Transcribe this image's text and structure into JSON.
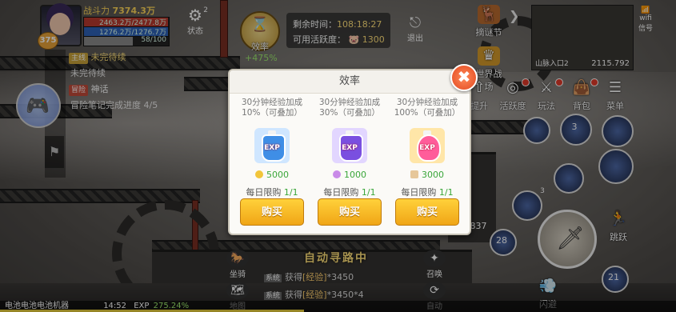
{
  "hud": {
    "power_label": "战斗力",
    "power_value": "7374.3万",
    "level": "375",
    "hp_text": "2463.2万/2477.8万",
    "mp_text": "1276.2万/1276.7万",
    "xp_text": "58/100",
    "status_label": "状态",
    "status_count": "2",
    "efficiency_label": "效率",
    "efficiency_bonus": "+475%",
    "timer_label": "剩余时间：",
    "timer_value": "108:18:27",
    "points_label": "可用活跃度：",
    "points_value": "1300",
    "exit_label": "退出"
  },
  "quests": [
    {
      "tag": "主线",
      "title": "未完待续",
      "sub": "未完待续"
    },
    {
      "tag": "冒险",
      "title": "神话",
      "sub_prefix": "冒险笔记完成进度",
      "sub_progress": "4/5"
    }
  ],
  "top_right": [
    {
      "label": "摘谜节",
      "icon": "deer-icon"
    },
    {
      "label": "世界战场",
      "icon": "crown-icon"
    },
    {
      "label": "提升",
      "icon": "arrow-up-icon"
    },
    {
      "label": "活跃度",
      "icon": "target-icon"
    },
    {
      "label": "玩法",
      "icon": "sword-icon"
    },
    {
      "label": "背包",
      "icon": "bag-icon"
    },
    {
      "label": "菜单",
      "icon": "menu-icon"
    }
  ],
  "minimap": {
    "location": "山脉入口2",
    "coords": "2115.792",
    "wifi_label": "wifi",
    "wifi_text": "信号"
  },
  "skills": {
    "count_a": "3",
    "count_b": "28",
    "count_c": "21",
    "count_d": "3",
    "count_e": "837",
    "jump_label": "跳跃",
    "dodge_label": "闪避",
    "auto_label": "自动"
  },
  "bottom": {
    "auto_path": "自动寻路中",
    "sys_tag": "系统",
    "log1_prefix": "获得",
    "log1_item": "[经验]",
    "log1_value": "*3450",
    "log2_prefix": "获得",
    "log2_item": "[经验]",
    "log2_value": "*3450*4",
    "mount_label": "坐骑",
    "map_label": "地图",
    "summon_label": "召唤",
    "time": "14:52",
    "exp_label": "EXP",
    "exp_value": "275.24%",
    "battery_text": "电池电池电池机器"
  },
  "dialog": {
    "title": "效率",
    "close_symbol": "✖",
    "items": [
      {
        "desc": "30分钟经验加成10%（可叠加）",
        "price": "5000",
        "limit_label": "每日限购",
        "limit_value": "1/1",
        "buy_label": "购买",
        "bottle_color": "#3f8ee6",
        "bg_color": "#cfe6ff",
        "coin_color": "#f2c53a"
      },
      {
        "desc": "30分钟经验加成30%（可叠加）",
        "price": "1000",
        "limit_label": "每日限购",
        "limit_value": "1/1",
        "buy_label": "购买",
        "bottle_color": "#7a4fe0",
        "bg_color": "#e2d6ff",
        "coin_color": "#c98be8"
      },
      {
        "desc": "30分钟经验加成100%（可叠加）",
        "price": "3000",
        "limit_label": "每日限购",
        "limit_value": "1/1",
        "buy_label": "购买",
        "bottle_color": "#ff5d9a",
        "bg_color": "#ffe6a8",
        "coin_color": "#e6c79a"
      }
    ]
  }
}
